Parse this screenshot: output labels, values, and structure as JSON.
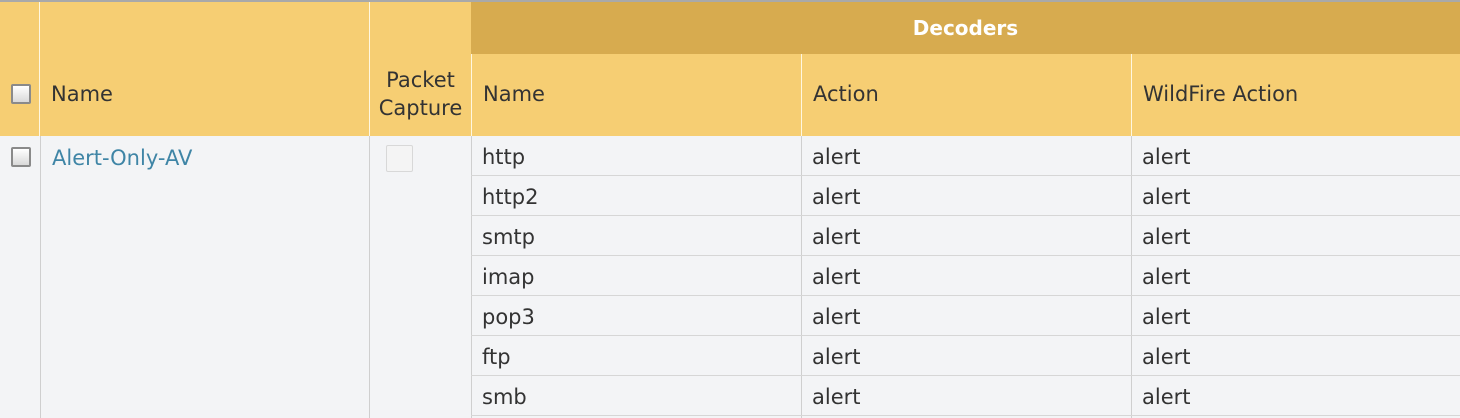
{
  "header": {
    "name": "Name",
    "packet_capture_line1": "Packet",
    "packet_capture_line2": "Capture",
    "decoders": "Decoders",
    "decoder_name": "Name",
    "action": "Action",
    "wildfire_action": "WildFire Action"
  },
  "profile": {
    "name": "Alert-Only-AV"
  },
  "decoders": [
    {
      "name": "http",
      "action": "alert",
      "wildfire_action": "alert"
    },
    {
      "name": "http2",
      "action": "alert",
      "wildfire_action": "alert"
    },
    {
      "name": "smtp",
      "action": "alert",
      "wildfire_action": "alert"
    },
    {
      "name": "imap",
      "action": "alert",
      "wildfire_action": "alert"
    },
    {
      "name": "pop3",
      "action": "alert",
      "wildfire_action": "alert"
    },
    {
      "name": "ftp",
      "action": "alert",
      "wildfire_action": "alert"
    },
    {
      "name": "smb",
      "action": "alert",
      "wildfire_action": "alert"
    }
  ],
  "colors": {
    "header_bg": "#f6ce73",
    "group_header_bg": "#d7ab4f",
    "link": "#3f85a6",
    "body_bg": "#f3f4f6"
  }
}
